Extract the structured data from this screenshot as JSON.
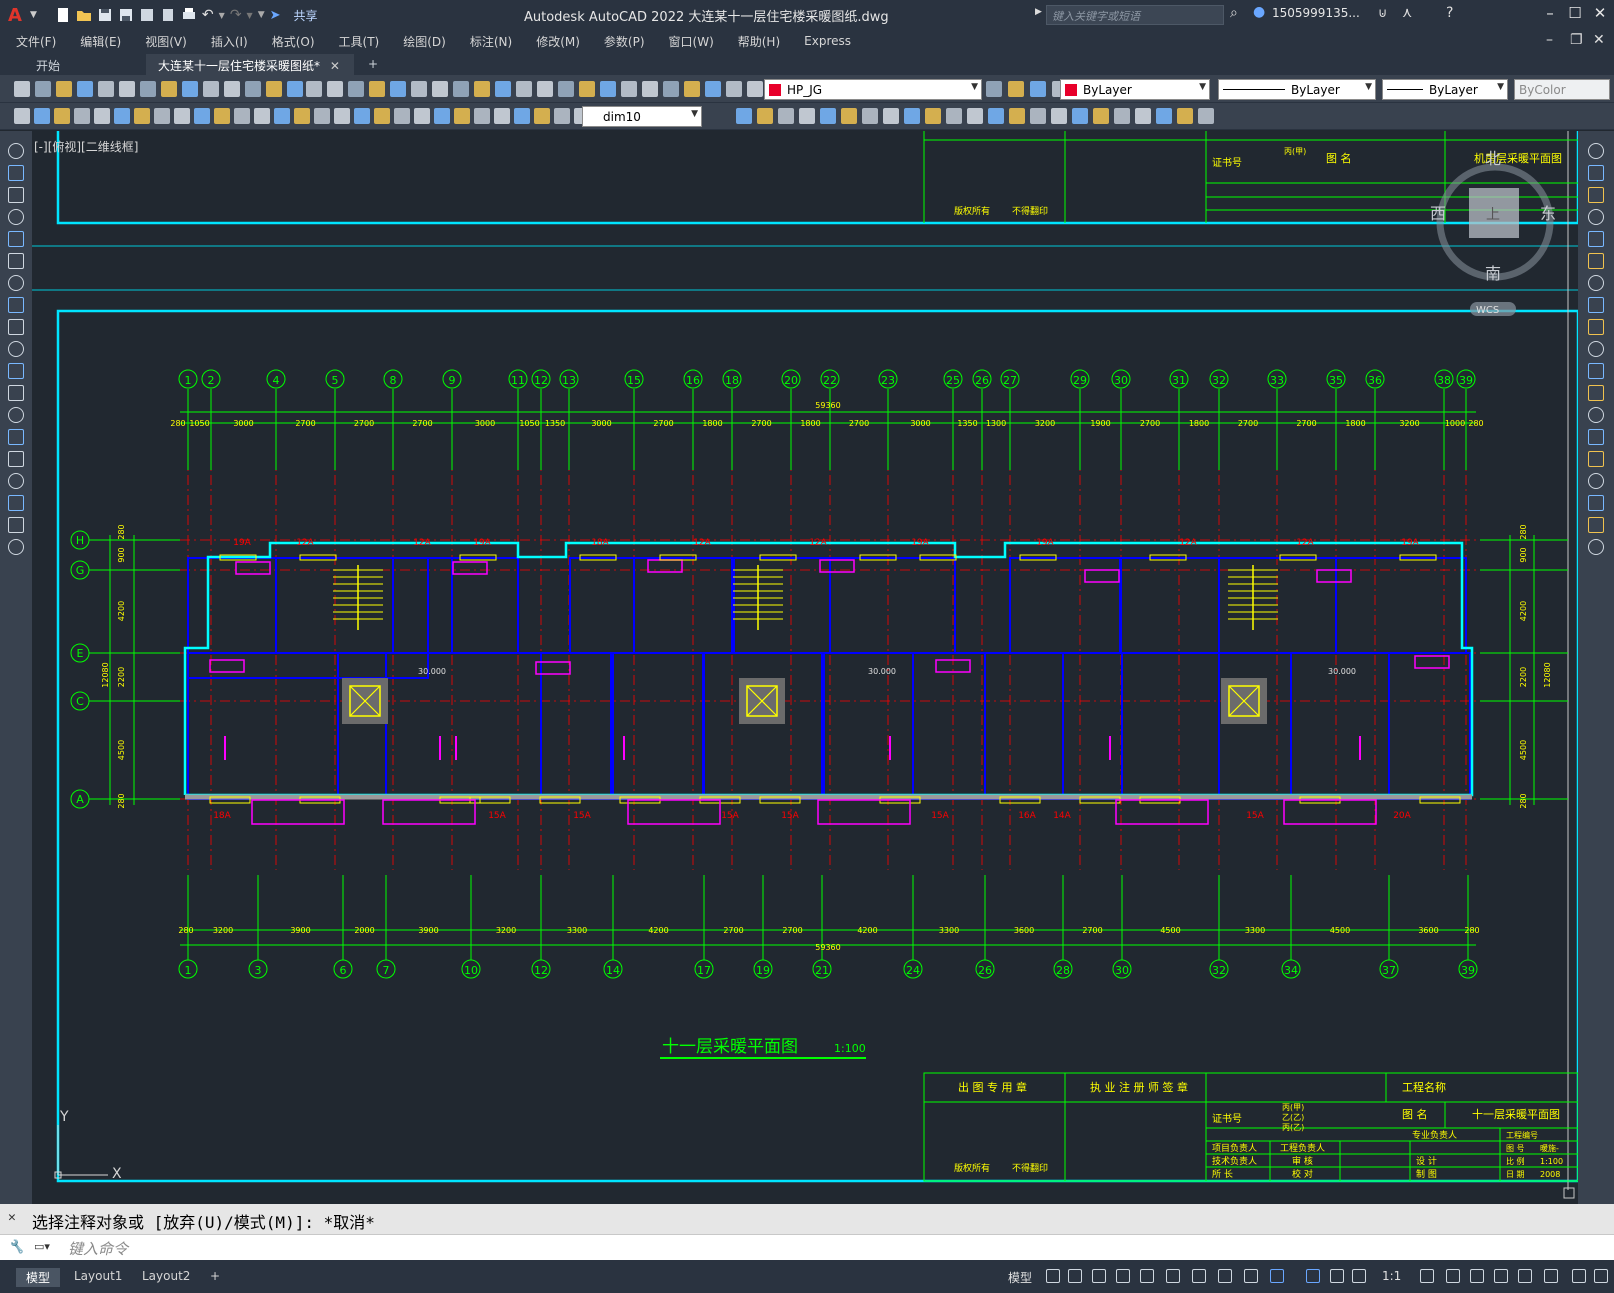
{
  "app": {
    "window_title": "Autodesk AutoCAD 2022    大连某十一层住宅楼采暖图纸.dwg",
    "share_label": "共享",
    "search_placeholder": "键入关键字或短语",
    "user_name": "1505999135..."
  },
  "menu": [
    "文件(F)",
    "编辑(E)",
    "视图(V)",
    "插入(I)",
    "格式(O)",
    "工具(T)",
    "绘图(D)",
    "标注(N)",
    "修改(M)",
    "参数(P)",
    "窗口(W)",
    "帮助(H)",
    "Express"
  ],
  "doc_tabs": {
    "start": "开始",
    "active": "大连某十一层住宅楼采暖图纸*",
    "close": "✕",
    "add": "+"
  },
  "toolbar": {
    "layer": "HP_JG",
    "color": "ByLayer",
    "linetype": "ByLayer",
    "lineweight": "ByLayer",
    "plotstyle": "ByColor",
    "dimstyle": "dim10",
    "layer_color": "#e8002a",
    "color_swatch": "#e8002a"
  },
  "viewport_label": "[-][俯视][二维线框]",
  "viewcube": {
    "north": "北",
    "south": "南",
    "east": "东",
    "west": "西",
    "top": "上",
    "wcs": "WCS"
  },
  "drawing": {
    "title": "十一层采暖平面图",
    "scale": "1:100",
    "grid_top": [
      "1",
      "2",
      "4",
      "5",
      "8",
      "9",
      "11",
      "12",
      "13",
      "15",
      "16",
      "18",
      "20",
      "22",
      "23",
      "25",
      "26",
      "27",
      "29",
      "30",
      "31",
      "32",
      "33",
      "35",
      "36",
      "38",
      "39"
    ],
    "grid_bottom": [
      "1",
      "3",
      "6",
      "7",
      "10",
      "12",
      "14",
      "17",
      "19",
      "21",
      "24",
      "26",
      "28",
      "30",
      "32",
      "34",
      "37",
      "39"
    ],
    "grid_rows": [
      "H",
      "G",
      "E",
      "C",
      "A"
    ],
    "top_dims": [
      "280",
      "1050",
      "3000",
      "2700",
      "2700",
      "2700",
      "3000",
      "1050",
      "1350",
      "3000",
      "2700",
      "1800",
      "2700",
      "1800",
      "2700",
      "3000",
      "1350",
      "1300",
      "3200",
      "1900",
      "2700",
      "1800",
      "2700",
      "2700",
      "1800",
      "3200",
      "1000",
      "280"
    ],
    "top_total": "59360",
    "bottom_dims": [
      "280",
      "3200",
      "3900",
      "2000",
      "3900",
      "3200",
      "3300",
      "4200",
      "2700",
      "2700",
      "4200",
      "3300",
      "3600",
      "2700",
      "4500",
      "3300",
      "4500",
      "3600",
      "280"
    ],
    "bottom_total": "59360",
    "left_dims": [
      "280",
      "900",
      "4200",
      "2200",
      "4500",
      "280"
    ],
    "left_total": "12080",
    "right_dims": [
      "280",
      "900",
      "4200",
      "2200",
      "4500",
      "280"
    ],
    "right_total": "12080",
    "pipe_tags_top": [
      "19A",
      "12A",
      "12A",
      "19A",
      "18A",
      "12A",
      "12A",
      "19A",
      "19A",
      "12A",
      "12A",
      "19A"
    ],
    "pipe_tags_bottom": [
      "18A",
      "15A",
      "15A",
      "15A",
      "15A",
      "15A",
      "16A",
      "14A",
      "15A",
      "20A"
    ],
    "elevations": [
      "30.000",
      "30.000",
      "30.000"
    ],
    "axes": {
      "x": "X",
      "y": "Y"
    }
  },
  "title_block": {
    "col1": "出 图 专 用 章",
    "col2": "执 业 注 册 师 签 章",
    "project_name": "工程名称",
    "drawing_name_label": "图 名",
    "drawing_name": "十一层采暖平面图",
    "top_drawing_name": "机房层采暖平面图",
    "cert": "证书号",
    "grade_lines": [
      "丙(甲)",
      "乙(乙)",
      "丙(乙)"
    ],
    "copyright": "版权所有",
    "no_copy": "不得翻印",
    "roles_left": [
      "项目负责人",
      "技术负责人",
      "所 长"
    ],
    "roles_mid": [
      "工程负责人",
      "审 核",
      "校 对"
    ],
    "roles_right": [
      "专业负责人",
      "设 计",
      "制 图"
    ],
    "right_labels": [
      "工程编号",
      "图 号",
      "比 例",
      "日 期"
    ],
    "right_values": [
      "",
      "暖施-",
      "1:100",
      "2008"
    ]
  },
  "command": {
    "history": "选择注释对象或 [放弃(U)/模式(M)]: *取消*",
    "placeholder": "键入命令"
  },
  "status": {
    "tabs": [
      "模型",
      "Layout1",
      "Layout2"
    ],
    "add": "+",
    "model": "模型",
    "scale": "1:1"
  },
  "colors": {
    "grid_green": "#00ff00",
    "axis_red": "#ff0000",
    "wall_blue": "#0000ff",
    "cyan": "#00ffff",
    "magenta": "#ff00ff",
    "yellow": "#ffff00"
  }
}
